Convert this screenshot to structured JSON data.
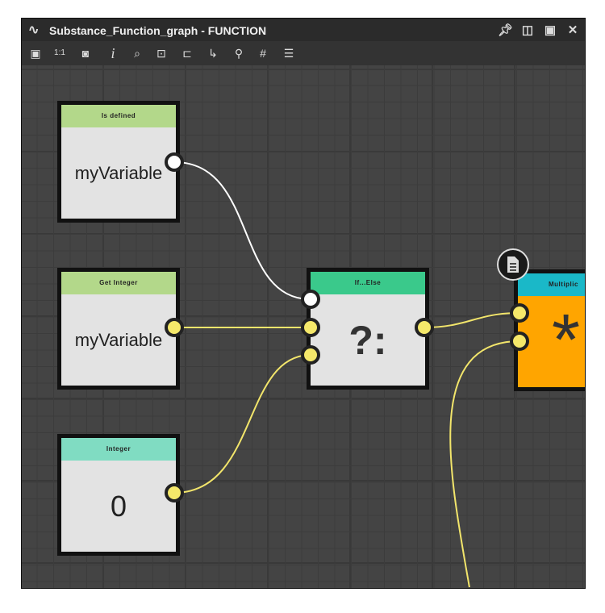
{
  "window": {
    "title": "Substance_Function_graph - FUNCTION"
  },
  "toolbar": [
    "frame-all",
    "zoom-1-1",
    "screenshot",
    "info",
    "search",
    "expose",
    "layout",
    "connect",
    "clean",
    "grid",
    "list"
  ],
  "toolbar_labels": {
    "zoom": "1:1",
    "info": "i"
  },
  "nodes": [
    {
      "title": "Is defined",
      "body": "myVariable",
      "color": "#b3d88a"
    },
    {
      "title": "Get Integer",
      "body": "myVariable",
      "color": "#b3d88a"
    },
    {
      "title": "Integer",
      "body": "0",
      "color": "#80dcc2"
    },
    {
      "title": "If...Else",
      "body": "?:",
      "color": "#3ac98b"
    },
    {
      "title": "Multiplic",
      "body": "*",
      "color": "#1ab8c8",
      "body_color": "#ffa500"
    }
  ],
  "colors": {
    "wire_int": "#f2e56b",
    "wire_bool": "#ffffff"
  }
}
